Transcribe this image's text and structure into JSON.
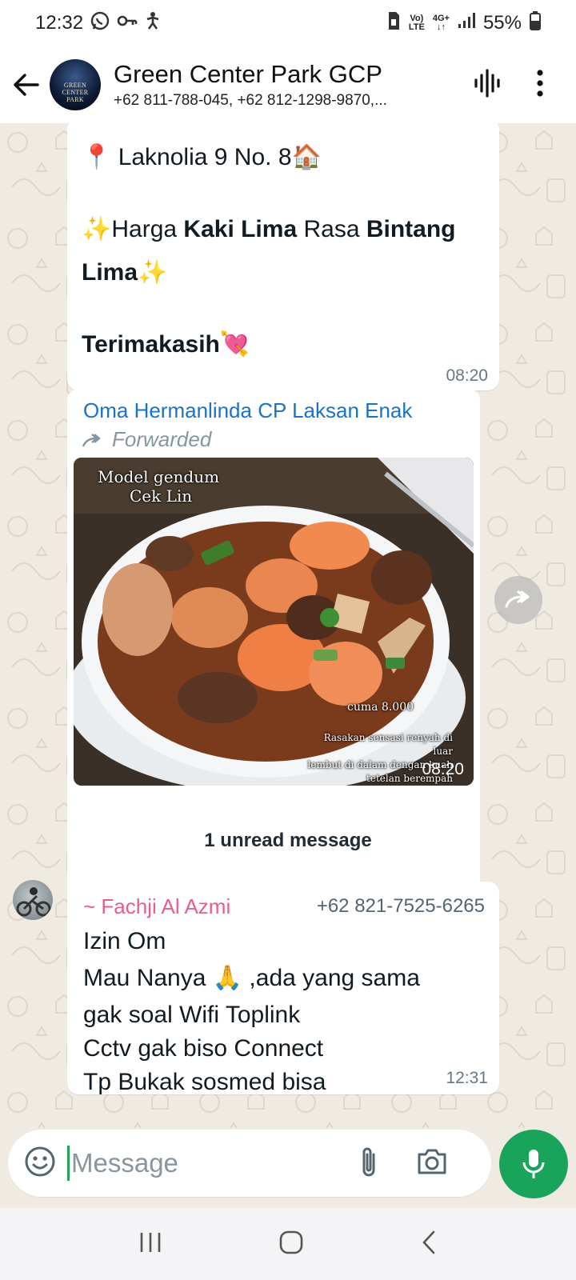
{
  "status_bar": {
    "time": "12:32",
    "volte_top": "Vo)",
    "volte_bottom": "LTE",
    "net_top": "4G+",
    "battery": "55%"
  },
  "header": {
    "title": "Green Center Park GCP",
    "subtitle": "+62 811-788-045, +62 812-1298-9870,...",
    "avatar_text": "GREEN CENTER PARK"
  },
  "messages": [
    {
      "lines": [
        "📍 Laknolia 9 No. 8🏠",
        "",
        "✨Harga ",
        "Kaki Lima",
        " Rasa ",
        "Bintang",
        "Lima",
        "✨",
        "",
        "Terimakasih",
        "💘"
      ],
      "time": "08:20"
    },
    {
      "sender": "Oma Hermanlinda CP Laksan Enak",
      "forwarded_label": "Forwarded",
      "image_caption_top_1": "Model gendum",
      "image_caption_top_2": "Cek Lin",
      "image_price": "cuma 8.000",
      "image_caption_bottom_1": "Rasakan sensasi renyah di luar",
      "image_caption_bottom_2": "lembut di dalam dengan kuah",
      "image_caption_bottom_3": "tetelan berempah",
      "time": "08:20"
    },
    {
      "sender": "~ Fachji Al Azmi",
      "phone": "+62 821-7525-6265",
      "lines": [
        "Izin Om",
        "Mau Nanya 🙏 ,ada yang sama",
        "gak soal Wifi Toplink",
        "Cctv gak biso Connect",
        "Tp Bukak sosmed bisa"
      ],
      "time": "12:31"
    }
  ],
  "unread_label": "1 unread message",
  "input": {
    "placeholder": "Message"
  },
  "colors": {
    "accent": "#1aa35a",
    "chat_bg": "#efeae2",
    "sender_blue": "#1873c9",
    "sender_pink": "#e85d91"
  }
}
